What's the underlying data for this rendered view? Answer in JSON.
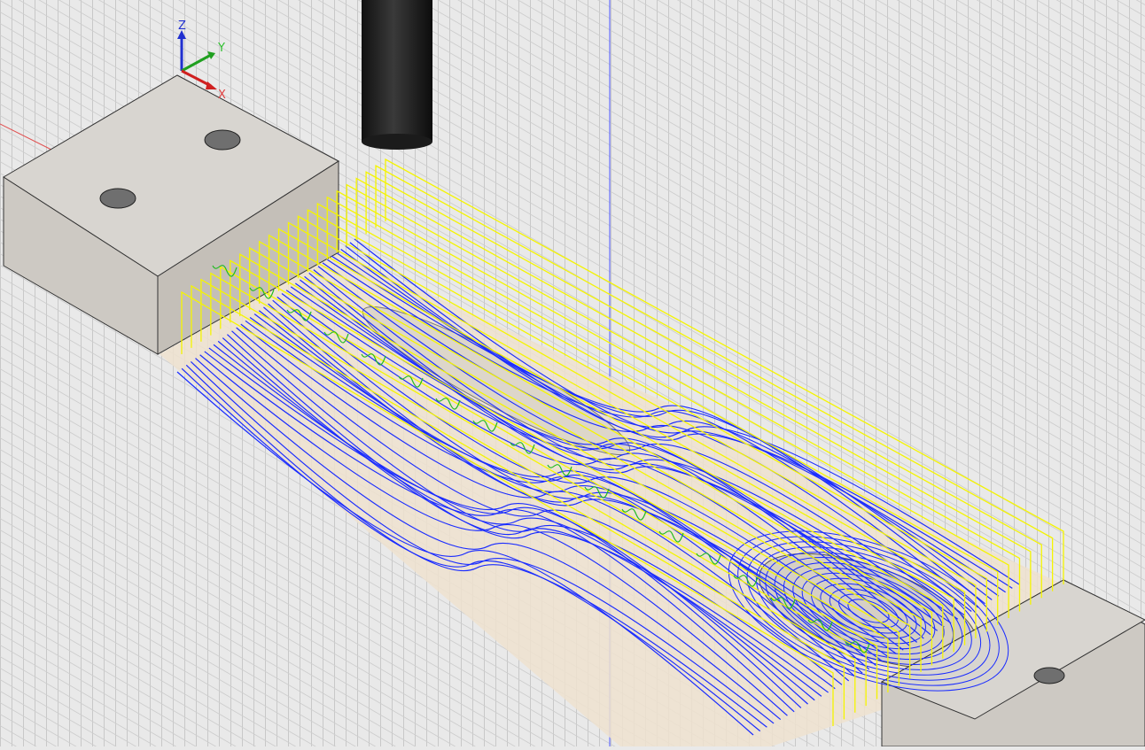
{
  "viewcube_axes": {
    "z_label": "Z",
    "y_label": "Y",
    "x_label": "X"
  },
  "colors": {
    "background": "#e9e9e9",
    "grid": "#c9c9c9",
    "toolpath_cutting": "#1a2cff",
    "toolpath_rapid": "#f5f500",
    "toolpath_leadin": "#22bb22",
    "stock_top": "#d6d3ce",
    "stock_side": "#c2bdb6",
    "part_floor": "#efe2cf",
    "tool": "#1a1a1a"
  }
}
